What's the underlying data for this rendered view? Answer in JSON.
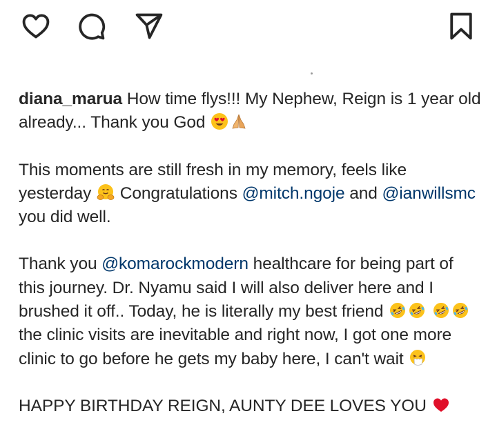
{
  "actions": {
    "like_icon": "heart-icon",
    "comment_icon": "comment-icon",
    "share_icon": "send-icon",
    "save_icon": "bookmark-icon"
  },
  "caption": {
    "username": "diana_marua",
    "p1": {
      "text1": " How time flys!!! My Nephew,  Reign is 1 year old already... Thank you God ",
      "emojis": [
        "heart-eyes-emoji",
        "folded-hands-emoji"
      ]
    },
    "p2": {
      "text1": "This moments are still fresh in my memory,  feels like yesterday ",
      "emoji": "hugging-face-emoji",
      "text2": " Congratulations ",
      "mention1": "@mitch.ngoje",
      "text3": " and ",
      "mention2": "@ianwillsmc",
      "text4": " you did well."
    },
    "p3": {
      "text1": "Thank you ",
      "mention": "@komarockmodern",
      "text2": " healthcare for being part of this journey.  Dr. Nyamu said I will also deliver here and I brushed it off.. Today,  he is literally my best friend ",
      "emojis": [
        "rolling-laughing-emoji",
        "rolling-laughing-emoji",
        "rolling-laughing-emoji",
        "rolling-laughing-emoji"
      ],
      "text3": " the clinic visits are inevitable and right now,  I got one more clinic to go before he gets my baby here,  I can't wait ",
      "emoji_end": "sneezing-face-emoji"
    },
    "p4": {
      "text1": "HAPPY BIRTHDAY REIGN,  AUNTY DEE LOVES  YOU ",
      "emoji": "red-heart-emoji"
    }
  },
  "colors": {
    "text": "#262626",
    "mention": "#00376b",
    "heart": "#e0102a",
    "emoji_yellow": "#fcc21b"
  }
}
